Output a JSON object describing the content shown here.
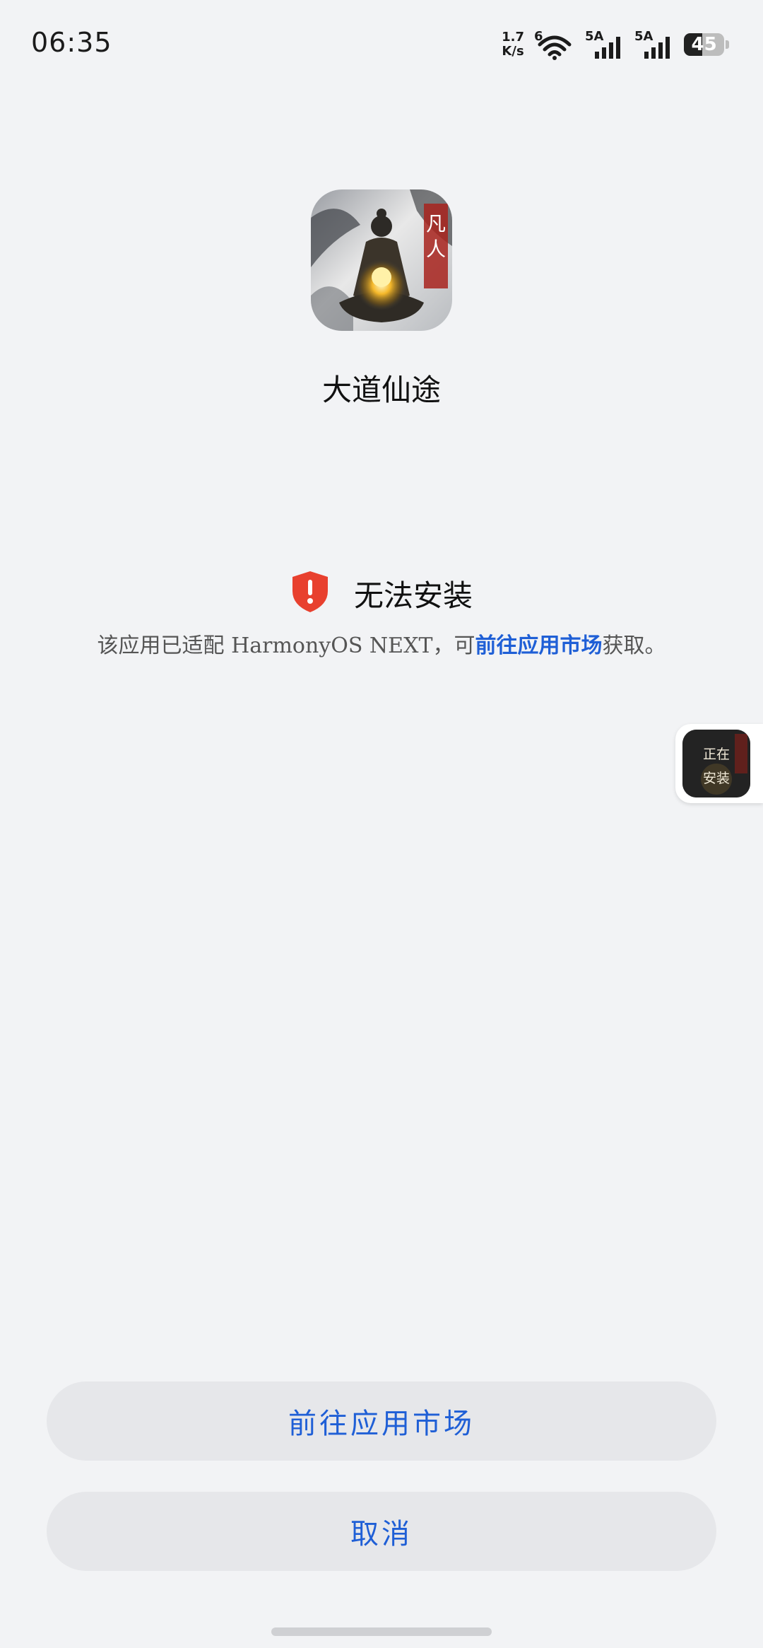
{
  "status_bar": {
    "time": "06:35",
    "net_speed_value": "1.7",
    "net_speed_unit": "K/s",
    "wifi_tag": "6",
    "sim1_tag": "5A",
    "sim2_tag": "5A",
    "battery_level": "45"
  },
  "app": {
    "icon": "meditating-figure-app-icon",
    "name": "大道仙途"
  },
  "warning": {
    "icon": "shield-alert-icon",
    "title": "无法安装",
    "desc_prefix": "该应用已适配 HarmonyOS NEXT，可",
    "desc_link": "前往应用市场",
    "desc_suffix": "获取。"
  },
  "installing_badge": {
    "label": "正在\n安装"
  },
  "buttons": {
    "market": "前往应用市场",
    "cancel": "取消"
  },
  "colors": {
    "accent": "#1f5fd6",
    "warning_red": "#e8402e",
    "background": "#f2f3f5",
    "button_bg": "#e6e7ea"
  }
}
